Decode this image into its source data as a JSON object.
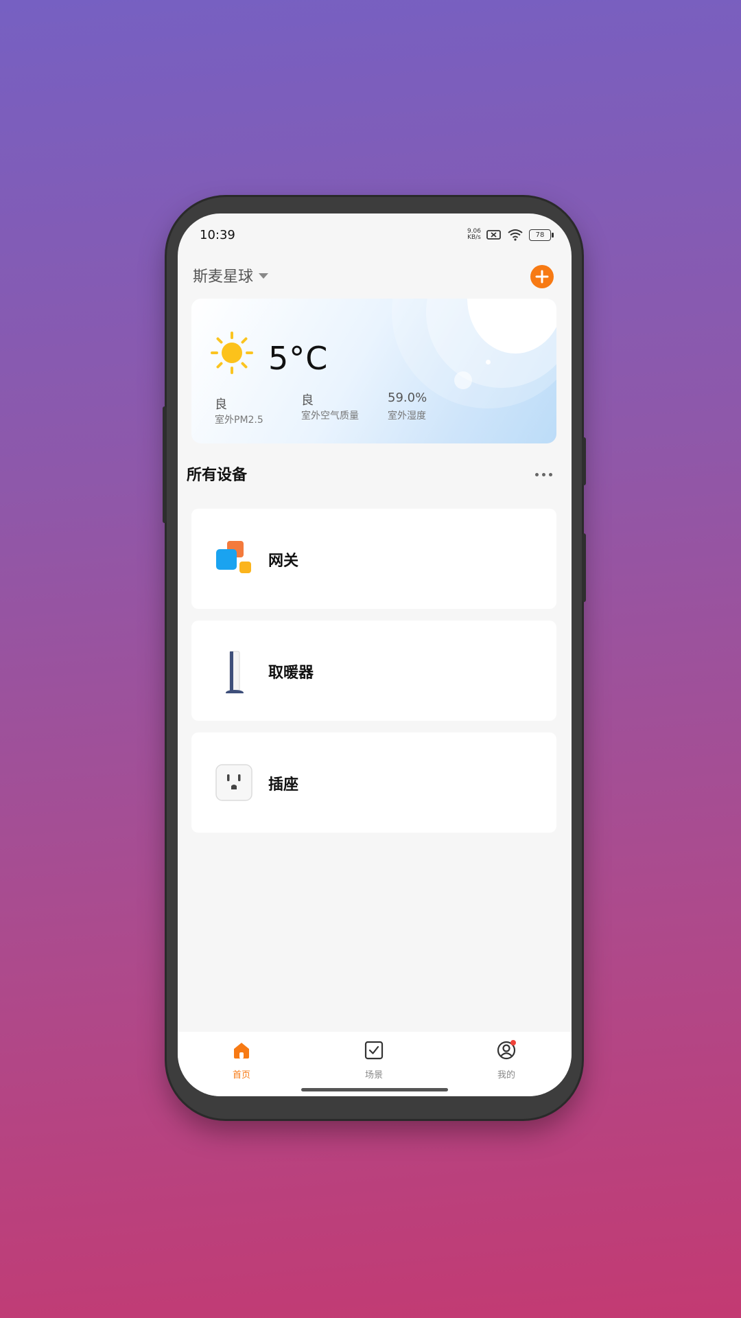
{
  "status_bar": {
    "time": "10:39",
    "net_speed_value": "9.06",
    "net_speed_unit": "KB/s",
    "battery": "78"
  },
  "header": {
    "home_name": "斯麦星球",
    "add_icon": "plus-icon"
  },
  "weather": {
    "icon": "sun-icon",
    "temperature": "5°C",
    "stats": [
      {
        "value": "良",
        "label": "室外PM2.5"
      },
      {
        "value": "良",
        "label": "室外空气质量"
      },
      {
        "value": "59.0%",
        "label": "室外湿度"
      }
    ]
  },
  "devices_section": {
    "title": "所有设备",
    "more_icon": "more-dots-icon"
  },
  "devices": [
    {
      "name": "网关",
      "icon": "gateway-icon"
    },
    {
      "name": "取暖器",
      "icon": "heater-icon"
    },
    {
      "name": "插座",
      "icon": "socket-icon"
    }
  ],
  "tabbar": {
    "tabs": [
      {
        "label": "首页",
        "icon": "home-icon",
        "active": true
      },
      {
        "label": "场景",
        "icon": "scene-checkbox-icon",
        "active": false
      },
      {
        "label": "我的",
        "icon": "profile-icon",
        "active": false
      }
    ]
  },
  "colors": {
    "accent": "#f77a14",
    "notification_dot": "#f0433a"
  }
}
